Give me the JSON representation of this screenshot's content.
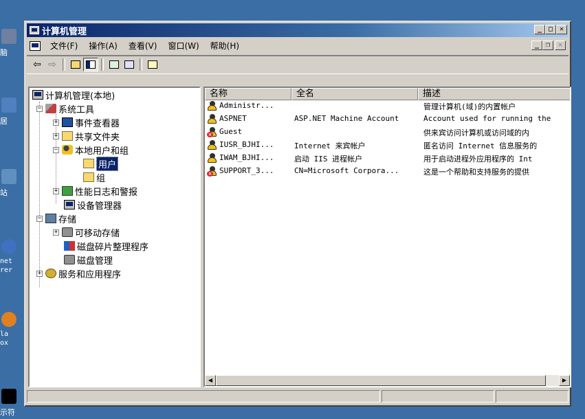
{
  "desktop": {
    "icons": [
      {
        "label": "脑",
        "icon": "my-computer-icon",
        "color": "#7080a0"
      },
      {
        "label": "居",
        "icon": "network-icon",
        "color": "#5080c0"
      },
      {
        "label": "站",
        "icon": "recycle-bin-icon",
        "color": "#6090c0"
      },
      {
        "label": "net\nrer",
        "icon": "internet-explorer-icon",
        "color": "#4070c0"
      },
      {
        "label": "la\nox",
        "icon": "firefox-icon",
        "color": "#e08020"
      },
      {
        "label": "示符",
        "icon": "command-prompt-icon",
        "color": "#000000"
      }
    ]
  },
  "window": {
    "title": "计算机管理",
    "controls": {
      "minimize": "_",
      "maximize": "□",
      "close": "✕"
    }
  },
  "menu": {
    "items": [
      "文件(F)",
      "操作(A)",
      "查看(V)",
      "窗口(W)",
      "帮助(H)"
    ],
    "child_controls": {
      "minimize": "_",
      "restore": "❐",
      "close": "✕"
    }
  },
  "toolbar": {
    "back": "⇦",
    "forward": "⇨",
    "up_icon": "up-folder-icon",
    "show_tree_icon": "show-hide-tree-icon",
    "refresh_icon": "refresh-icon",
    "export_icon": "export-list-icon",
    "help_icon": "help-icon"
  },
  "tree": {
    "root": "计算机管理(本地)",
    "system_tools": "系统工具",
    "event_viewer": "事件查看器",
    "shared_folders": "共享文件夹",
    "local_users_groups": "本地用户和组",
    "users": "用户",
    "groups": "组",
    "perf_logs": "性能日志和警报",
    "device_manager": "设备管理器",
    "storage": "存储",
    "removable_storage": "可移动存储",
    "defrag": "磁盘碎片整理程序",
    "disk_mgmt": "磁盘管理",
    "services_apps": "服务和应用程序"
  },
  "list": {
    "headers": [
      "名称",
      "全名",
      "描述"
    ],
    "rows": [
      {
        "name": "Administr...",
        "fullname": "",
        "desc": "管理计算机(域)的内置帐户",
        "disabled": false
      },
      {
        "name": "ASPNET",
        "fullname": "ASP.NET Machine Account",
        "desc": "Account used for running the",
        "disabled": false
      },
      {
        "name": "Guest",
        "fullname": "",
        "desc": "供来宾访问计算机或访问域的内",
        "disabled": true
      },
      {
        "name": "IUSR_BJHI...",
        "fullname": "Internet 来宾帐户",
        "desc": "匿名访问 Internet 信息服务的",
        "disabled": false
      },
      {
        "name": "IWAM_BJHI...",
        "fullname": "启动 IIS 进程帐户",
        "desc": "用于启动进程外应用程序的 Int",
        "disabled": false
      },
      {
        "name": "SUPPORT_3...",
        "fullname": "CN=Microsoft Corpora...",
        "desc": "这是一个帮助和支持服务的提供",
        "disabled": true
      }
    ]
  },
  "scroll": {
    "left": "◀",
    "right": "▶"
  }
}
